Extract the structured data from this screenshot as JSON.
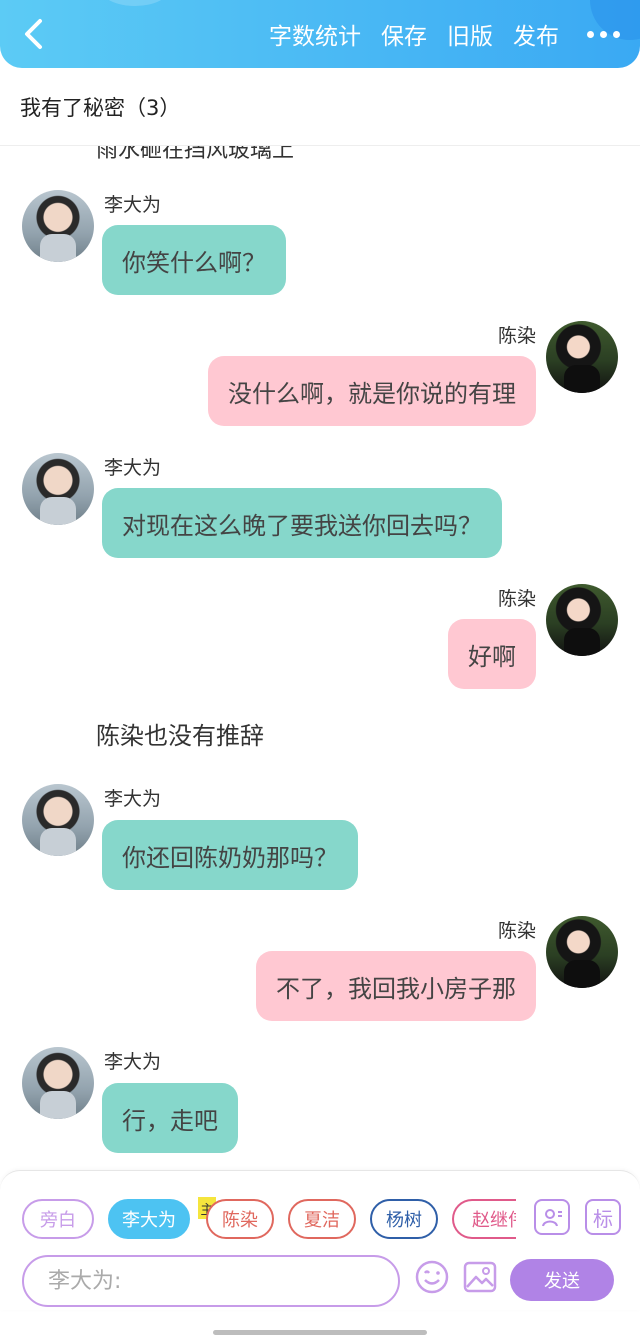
{
  "header": {
    "actions": [
      "字数统计",
      "保存",
      "旧版",
      "发布"
    ],
    "back_icon": "chevron-left-icon",
    "more_icon": "more-dots-icon"
  },
  "title": "我有了秘密（3）",
  "chat": {
    "clipped_text": "雨水砸在挡风玻璃上",
    "messages": [
      {
        "side": "left",
        "name": "李大为",
        "text": "你笑什么啊？"
      },
      {
        "side": "right",
        "name": "陈染",
        "text": "没什么啊，就是你说的有理"
      },
      {
        "side": "left",
        "name": "李大为",
        "text": "对现在这么晚了要我送你回去吗？"
      },
      {
        "side": "right",
        "name": "陈染",
        "text": "好啊"
      },
      {
        "side": "narration",
        "text": "陈染也没有推辞"
      },
      {
        "side": "left",
        "name": "李大为",
        "text": "你还回陈奶奶那吗？"
      },
      {
        "side": "right",
        "name": "陈染",
        "text": "不了，我回我小房子那"
      },
      {
        "side": "left",
        "name": "李大为",
        "text": "行，走吧"
      }
    ]
  },
  "panel": {
    "characters": [
      {
        "label": "旁白",
        "color": "#c79ce9",
        "active": false
      },
      {
        "label": "李大为",
        "color": "#4dc3f2",
        "active": true
      },
      {
        "label": "陈染",
        "color": "#e0685e",
        "active": false
      },
      {
        "label": "夏洁",
        "color": "#e0685e",
        "active": false
      },
      {
        "label": "杨树",
        "color": "#2f5fa8",
        "active": false
      },
      {
        "label": "赵继伟",
        "color": "#e05a8a",
        "active": false
      }
    ],
    "main_badge": "主",
    "mark_label": "标",
    "input_placeholder": "李大为:",
    "send_label": "发送",
    "accent": "#b083e6"
  }
}
